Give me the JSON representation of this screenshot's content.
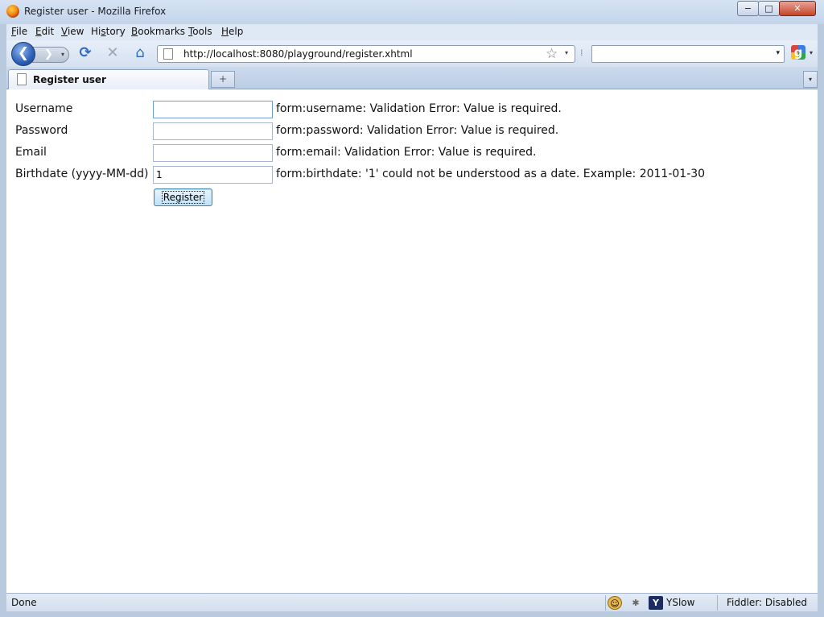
{
  "window": {
    "title": "Register user - Mozilla Firefox",
    "minimize": "−",
    "maximize": "□",
    "close": "✕"
  },
  "menubar": {
    "items": [
      {
        "mnemonic": "F",
        "rest": "ile"
      },
      {
        "mnemonic": "E",
        "rest": "dit"
      },
      {
        "mnemonic": "V",
        "rest": "iew"
      },
      {
        "pre": "Hi",
        "mnemonic": "s",
        "rest": "tory"
      },
      {
        "mnemonic": "B",
        "rest": "ookmarks"
      },
      {
        "mnemonic": "T",
        "rest": "ools"
      },
      {
        "mnemonic": "H",
        "rest": "elp"
      }
    ]
  },
  "navbar": {
    "back_glyph": "❮",
    "forward_glyph": "❯",
    "dropdown_glyph": "▾",
    "reload_glyph": "⟳",
    "stop_glyph": "✕",
    "home_glyph": "⌂",
    "url": "http://localhost:8080/playground/register.xhtml",
    "bookmark_glyph": "☆",
    "search_value": "",
    "search_engine_glyph": "g"
  },
  "tabs": [
    {
      "title": "Register user"
    }
  ],
  "tabstrip": {
    "new_tab_glyph": "+",
    "list_tabs_glyph": "▾"
  },
  "form": {
    "rows": [
      {
        "label": "Username",
        "value": "",
        "message": "form:username: Validation Error: Value is required."
      },
      {
        "label": "Password",
        "value": "",
        "message": "form:password: Validation Error: Value is required."
      },
      {
        "label": "Email",
        "value": "",
        "message": "form:email: Validation Error: Value is required."
      },
      {
        "label": "Birthdate (yyyy-MM-dd)",
        "value": "1",
        "message": "form:birthdate: '1' could not be understood as a date. Example: 2011-01-30"
      }
    ],
    "submit_label": "Register"
  },
  "statusbar": {
    "status": "Done",
    "yslow_label": "YSlow",
    "fiddler_label": "Fiddler: Disabled"
  }
}
